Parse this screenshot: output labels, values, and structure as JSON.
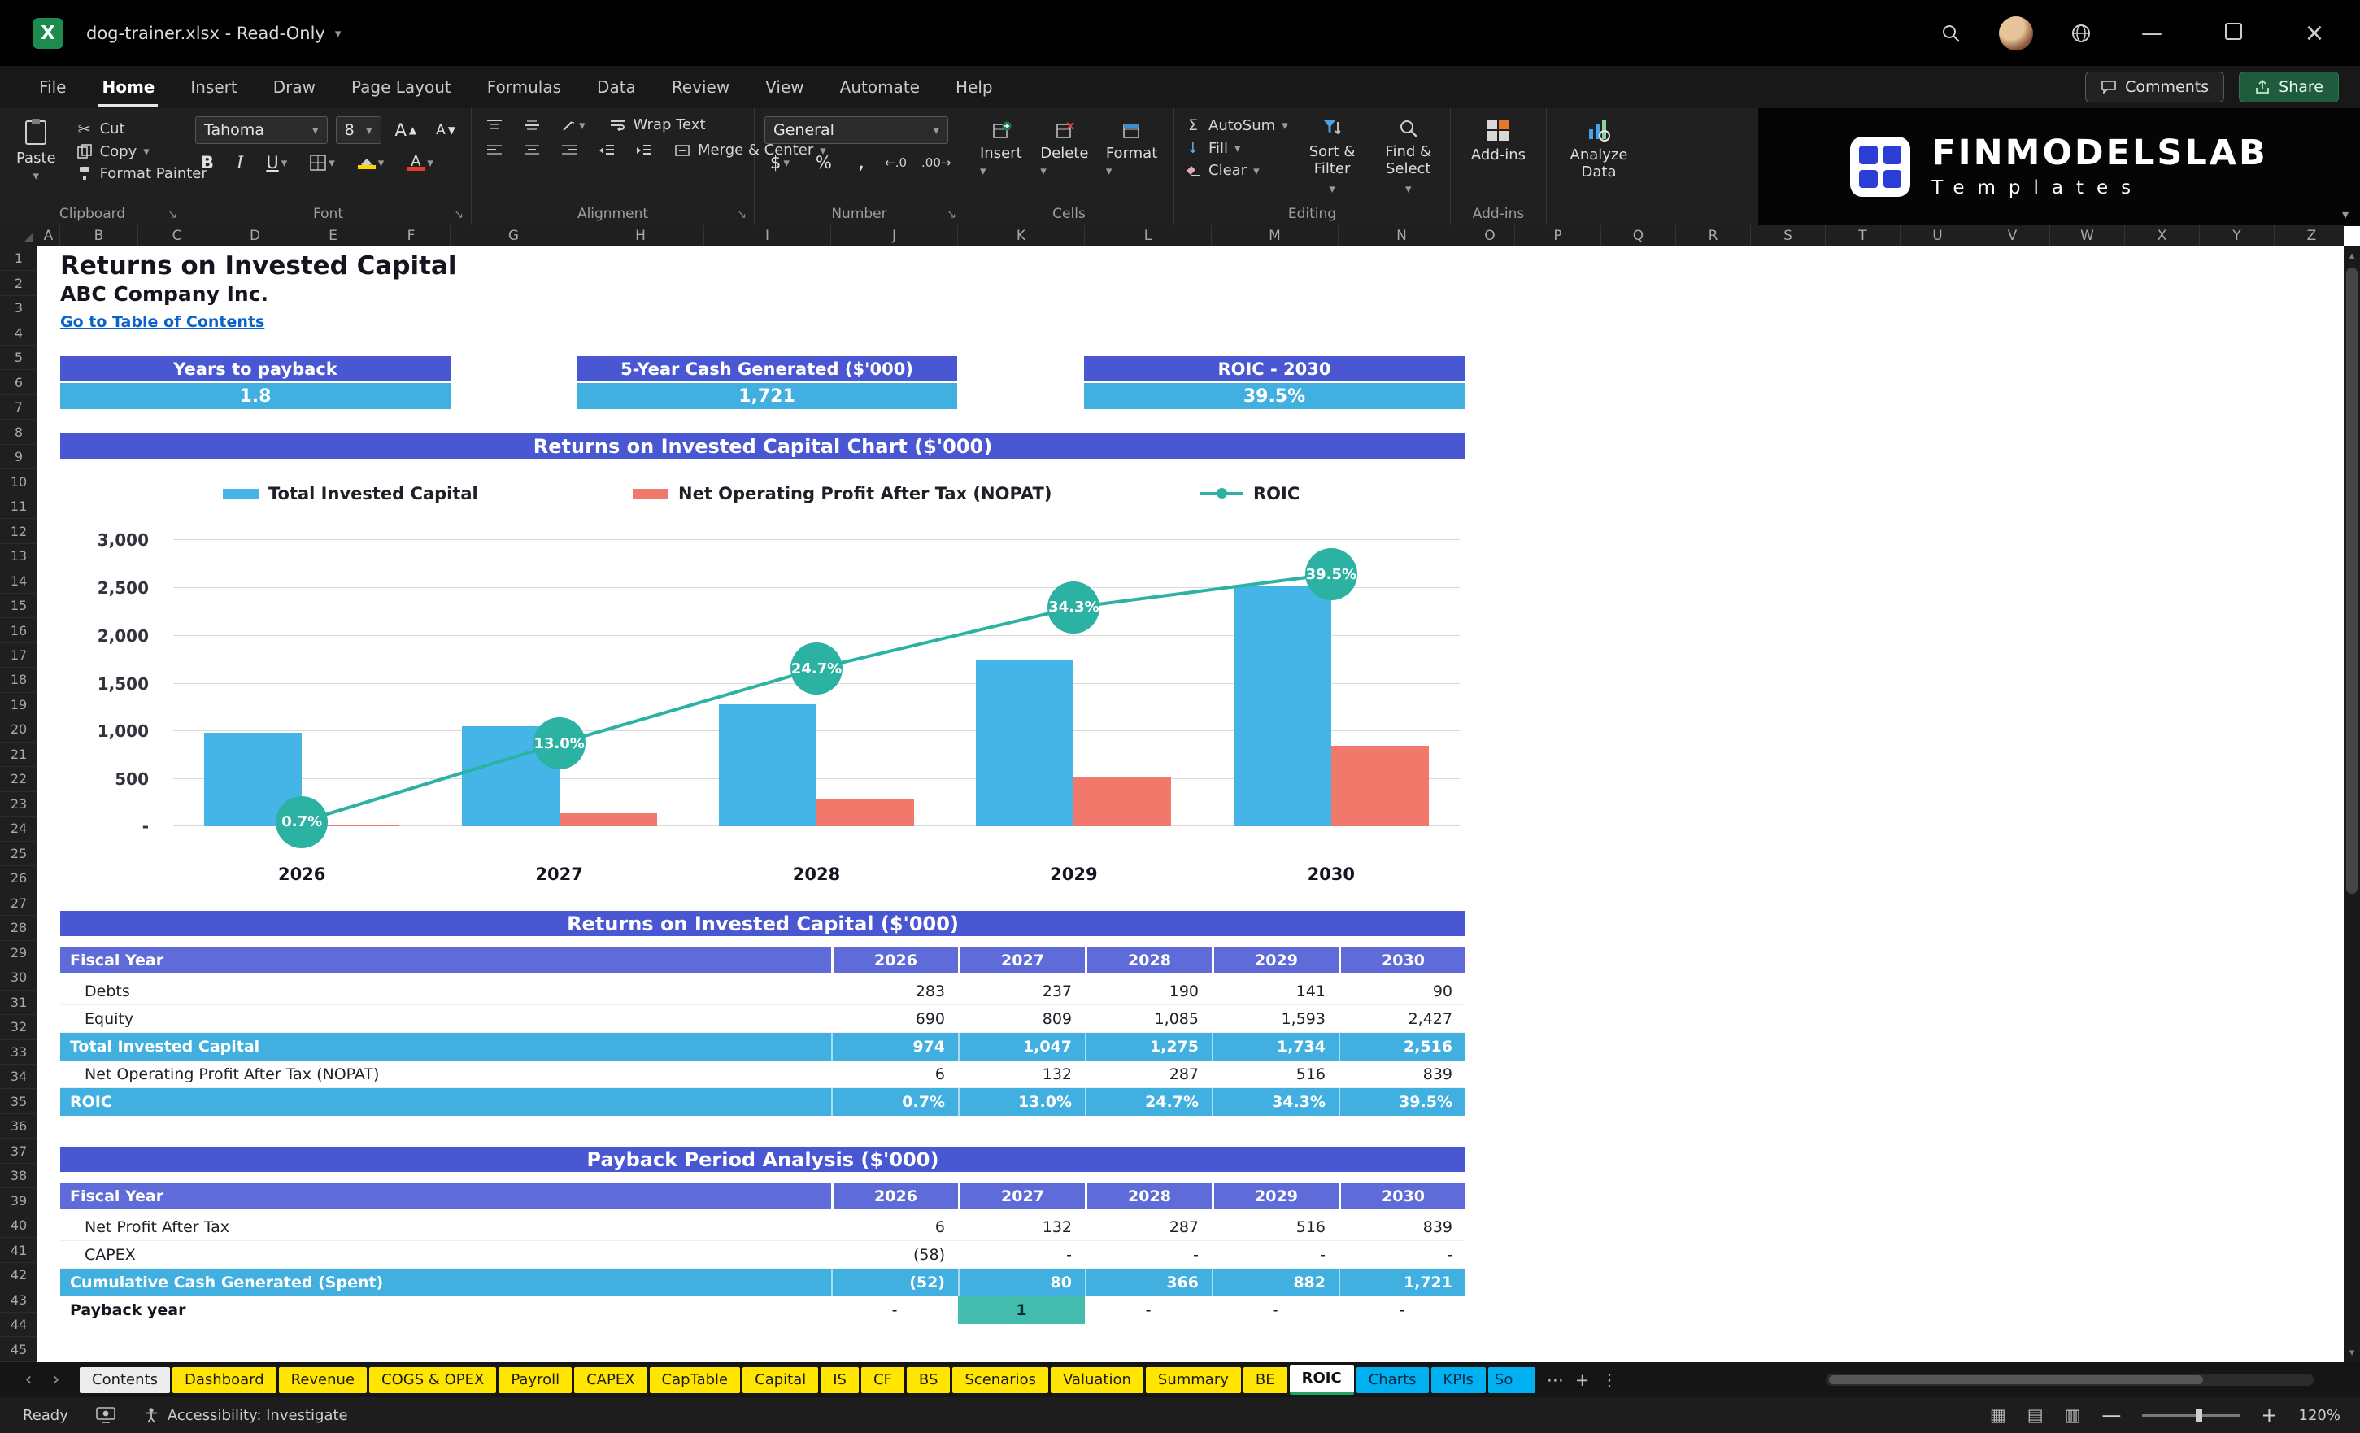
{
  "colors": {
    "header_blue": "#4a57d3",
    "fiscal_blue": "#5e6bd8",
    "value_blue": "#41afe0",
    "bar_blue": "#45b5e8",
    "bar_salmon": "#f0796c",
    "line_teal": "#2cb2a2",
    "payback_highlight": "#43bcae",
    "tab_yellow": "#ffe500",
    "tab_blue": "#00b0f0",
    "link_blue": "#0a63c9"
  },
  "title_bar": {
    "display": "dog-trainer.xlsx  -  Read-Only",
    "file_name": "dog-trainer.xlsx",
    "mode": "Read-Only"
  },
  "menu": {
    "items": [
      "File",
      "Home",
      "Insert",
      "Draw",
      "Page Layout",
      "Formulas",
      "Data",
      "Review",
      "View",
      "Automate",
      "Help"
    ],
    "active": "Home",
    "comments_label": "Comments",
    "share_label": "Share"
  },
  "ribbon": {
    "font_name": "Tahoma",
    "font_size": "8",
    "number_format": "General",
    "labels": {
      "paste": "Paste",
      "cut": "Cut",
      "copy": "Copy",
      "format_painter": "Format Painter",
      "wrap_text": "Wrap Text",
      "merge_center": "Merge & Center",
      "insert": "Insert",
      "delete": "Delete",
      "format": "Format",
      "autosum": "AutoSum",
      "fill": "Fill",
      "clear": "Clear",
      "sort_filter": "Sort & Filter",
      "find_select": "Find & Select",
      "addins": "Add-ins",
      "analyze_data": "Analyze Data"
    },
    "groups": [
      "Clipboard",
      "Font",
      "Alignment",
      "Number",
      "Cells",
      "Editing",
      "Add-ins"
    ]
  },
  "brand": {
    "name": "FINMODELSLAB",
    "subtitle": "Templates"
  },
  "grid": {
    "columns": [
      "A",
      "B",
      "C",
      "D",
      "E",
      "F",
      "G",
      "H",
      "I",
      "J",
      "K",
      "L",
      "M",
      "N",
      "O",
      "P",
      "Q",
      "R",
      "S",
      "T",
      "U",
      "V",
      "W",
      "X",
      "Y",
      "Z"
    ],
    "row_start": 1,
    "row_end": 45
  },
  "sheet": {
    "title": "Returns on Invested Capital",
    "company": "ABC Company Inc.",
    "link": "Go to Table of Contents",
    "kpis": [
      {
        "label": "Years to payback",
        "value": "1.8"
      },
      {
        "label": "5-Year Cash Generated ($'000)",
        "value": "1,721"
      },
      {
        "label": "ROIC - 2030",
        "value": "39.5%"
      }
    ]
  },
  "chart_data": {
    "type": "combo_bar_line",
    "title": "Returns on Invested Capital Chart ($'000)",
    "categories": [
      "2026",
      "2027",
      "2028",
      "2029",
      "2030"
    ],
    "series": [
      {
        "name": "Total Invested Capital",
        "type": "bar",
        "values": [
          974,
          1047,
          1275,
          1734,
          2516
        ]
      },
      {
        "name": "Net Operating Profit After Tax (NOPAT)",
        "type": "bar",
        "values": [
          6,
          132,
          287,
          516,
          839
        ]
      },
      {
        "name": "ROIC",
        "type": "line",
        "values_pct": [
          0.7,
          13.0,
          24.7,
          34.3,
          39.5
        ],
        "point_labels": [
          "0.7%",
          "13.0%",
          "24.7%",
          "34.3%",
          "39.5%"
        ]
      }
    ],
    "y_axis": {
      "min": 0,
      "max": 3000,
      "step": 500,
      "tick_labels_bottom_up": [
        "-",
        "500",
        "1,000",
        "1,500",
        "2,000",
        "2,500",
        "3,000"
      ]
    },
    "secondary_axis": {
      "min": 0,
      "max": 45
    },
    "grid": true,
    "legend_position": "top"
  },
  "tables": [
    {
      "title": "Returns on Invested Capital ($'000)",
      "header_row": {
        "label": "Fiscal Year",
        "years": [
          "2026",
          "2027",
          "2028",
          "2029",
          "2030"
        ]
      },
      "rows": [
        {
          "label": "Debts",
          "values": [
            "283",
            "237",
            "190",
            "141",
            "90"
          ],
          "style": "normal"
        },
        {
          "label": "Equity",
          "values": [
            "690",
            "809",
            "1,085",
            "1,593",
            "2,427"
          ],
          "style": "normal"
        },
        {
          "label": "Total Invested Capital",
          "values": [
            "974",
            "1,047",
            "1,275",
            "1,734",
            "2,516"
          ],
          "style": "total"
        },
        {
          "label": "Net Operating Profit After Tax (NOPAT)",
          "values": [
            "6",
            "132",
            "287",
            "516",
            "839"
          ],
          "style": "normal"
        },
        {
          "label": "ROIC",
          "values": [
            "0.7%",
            "13.0%",
            "24.7%",
            "34.3%",
            "39.5%"
          ],
          "style": "total"
        }
      ]
    },
    {
      "title": "Payback Period Analysis ($'000)",
      "header_row": {
        "label": "Fiscal Year",
        "years": [
          "2026",
          "2027",
          "2028",
          "2029",
          "2030"
        ]
      },
      "rows": [
        {
          "label": "Net Profit After Tax",
          "values": [
            "6",
            "132",
            "287",
            "516",
            "839"
          ],
          "style": "normal"
        },
        {
          "label": "CAPEX",
          "values": [
            "(58)",
            "-",
            "-",
            "-",
            "-"
          ],
          "style": "normal"
        },
        {
          "label": "Cumulative Cash Generated (Spent)",
          "values": [
            "(52)",
            "80",
            "366",
            "882",
            "1,721"
          ],
          "style": "total"
        },
        {
          "label": "Payback year",
          "values": [
            "-",
            "1",
            "-",
            "-",
            "-"
          ],
          "style": "payback",
          "highlight_index": 1
        }
      ]
    }
  ],
  "sheet_tabs": [
    {
      "label": "Contents",
      "color": "white"
    },
    {
      "label": "Dashboard",
      "color": "yellow"
    },
    {
      "label": "Revenue",
      "color": "yellow"
    },
    {
      "label": "COGS & OPEX",
      "color": "yellow"
    },
    {
      "label": "Payroll",
      "color": "yellow"
    },
    {
      "label": "CAPEX",
      "color": "yellow"
    },
    {
      "label": "CapTable",
      "color": "yellow"
    },
    {
      "label": "Capital",
      "color": "yellow"
    },
    {
      "label": "IS",
      "color": "yellow"
    },
    {
      "label": "CF",
      "color": "yellow"
    },
    {
      "label": "BS",
      "color": "yellow"
    },
    {
      "label": "Scenarios",
      "color": "yellow"
    },
    {
      "label": "Valuation",
      "color": "yellow"
    },
    {
      "label": "Summary",
      "color": "yellow"
    },
    {
      "label": "BE",
      "color": "yellow"
    },
    {
      "label": "ROIC",
      "color": "active"
    },
    {
      "label": "Charts",
      "color": "blue"
    },
    {
      "label": "KPIs",
      "color": "blue"
    },
    {
      "label": "So",
      "color": "blue",
      "partial": true
    }
  ],
  "status_bar": {
    "ready": "Ready",
    "accessibility": "Accessibility: Investigate",
    "zoom": "120%"
  }
}
